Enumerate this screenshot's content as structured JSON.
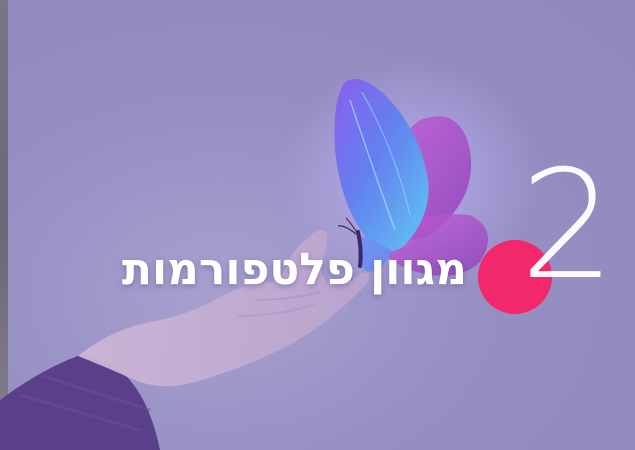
{
  "slide": {
    "number": "2",
    "title": "מגוון פלטפורמות",
    "colors": {
      "background": "#968fc3",
      "accent_dot": "#f2286a",
      "text": "#ffffff"
    },
    "image": {
      "icon": "hand-with-butterfly-image"
    }
  }
}
